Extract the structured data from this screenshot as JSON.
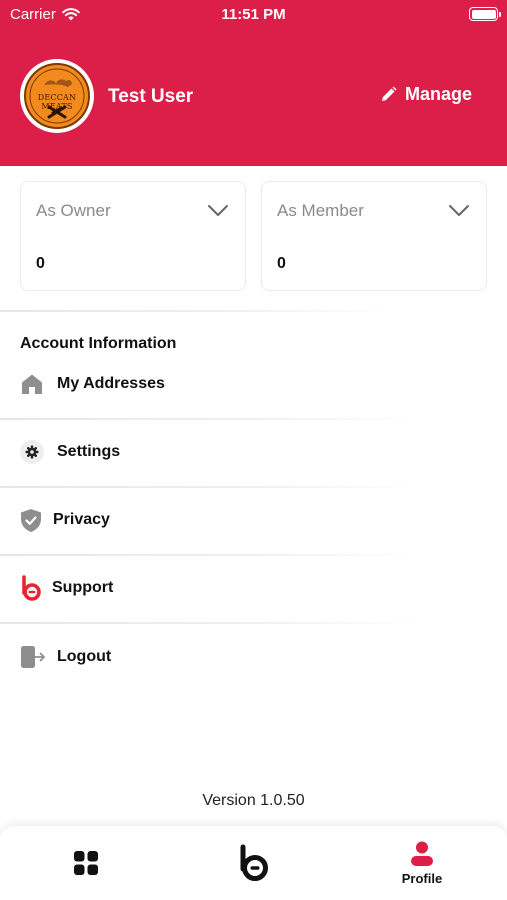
{
  "status_bar": {
    "carrier": "Carrier",
    "time": "11:51 PM"
  },
  "header": {
    "user_name": "Test User",
    "manage_label": "Manage",
    "avatar_text": "DECCAN MEATS",
    "accent_color": "#dc1f48"
  },
  "cards": [
    {
      "title": "As Owner",
      "value": "0"
    },
    {
      "title": "As Member",
      "value": "0"
    }
  ],
  "section_title": "Account Information",
  "menu": [
    {
      "label": "My Addresses",
      "icon": "home-icon"
    },
    {
      "label": "Settings",
      "icon": "gear-icon"
    },
    {
      "label": "Privacy",
      "icon": "shield-icon"
    },
    {
      "label": "Support",
      "icon": "brand-logo-icon"
    },
    {
      "label": "Logout",
      "icon": "logout-icon"
    }
  ],
  "version": "Version 1.0.50",
  "tabbar": {
    "tabs": [
      {
        "icon": "grid-icon",
        "label": ""
      },
      {
        "icon": "brand-logo-icon",
        "label": ""
      },
      {
        "icon": "profile-icon",
        "label": "Profile"
      }
    ]
  }
}
